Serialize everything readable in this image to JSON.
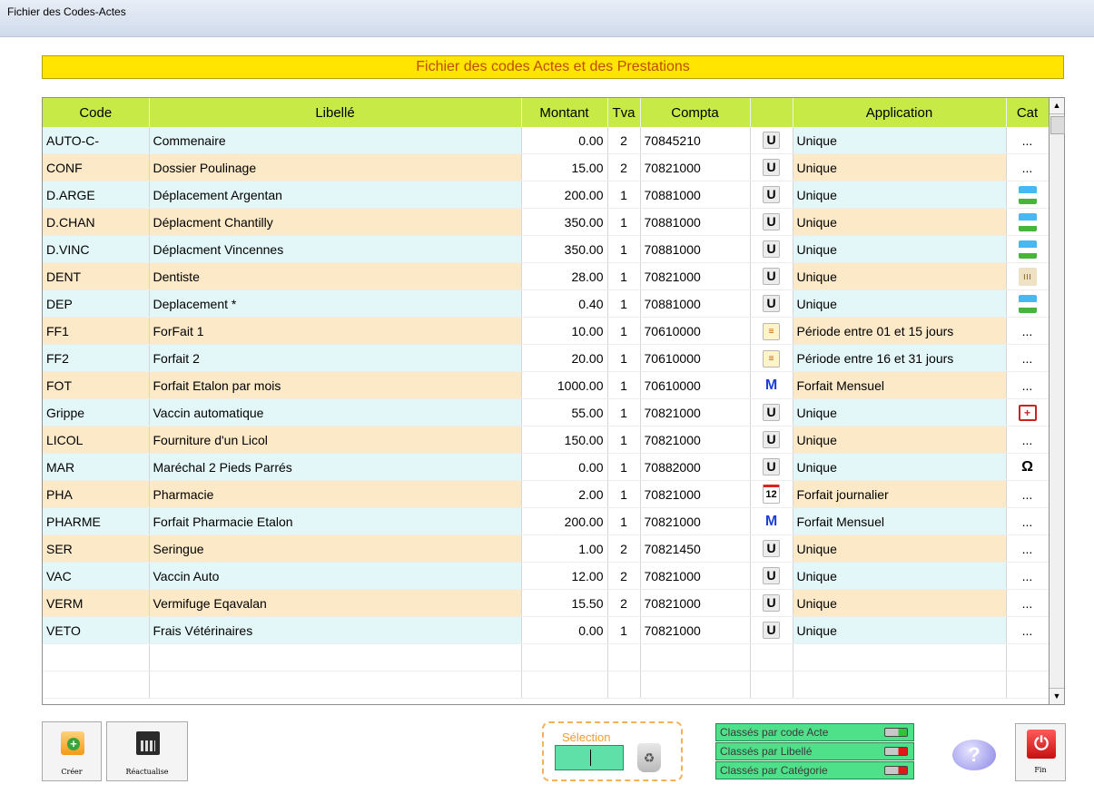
{
  "window": {
    "title": "Fichier des Codes-Actes"
  },
  "banner": {
    "title": "Fichier des codes Actes et des Prestations"
  },
  "table": {
    "headers": {
      "code": "Code",
      "libelle": "Libellé",
      "montant": "Montant",
      "tva": "Tva",
      "compta": "Compta",
      "icon": "",
      "application": "Application",
      "cat": "Cat"
    },
    "rows": [
      {
        "code": "AUTO-C-",
        "libelle": "Commenaire",
        "montant": "0.00",
        "tva": "2",
        "compta": "70845210",
        "app_icon": "U",
        "application": "Unique",
        "cat": "..."
      },
      {
        "code": "CONF",
        "libelle": "Dossier Poulinage",
        "montant": "15.00",
        "tva": "2",
        "compta": "70821000",
        "app_icon": "U",
        "application": "Unique",
        "cat": "..."
      },
      {
        "code": "D.ARGE",
        "libelle": "Déplacement Argentan",
        "montant": "200.00",
        "tva": "1",
        "compta": "70881000",
        "app_icon": "U",
        "application": "Unique",
        "cat": "van-icon"
      },
      {
        "code": "D.CHAN",
        "libelle": "Déplacment Chantilly",
        "montant": "350.00",
        "tva": "1",
        "compta": "70881000",
        "app_icon": "U",
        "application": "Unique",
        "cat": "van-icon"
      },
      {
        "code": "D.VINC",
        "libelle": "Déplacment Vincennes",
        "montant": "350.00",
        "tva": "1",
        "compta": "70881000",
        "app_icon": "U",
        "application": "Unique",
        "cat": "van-icon"
      },
      {
        "code": "DENT",
        "libelle": "Dentiste",
        "montant": "28.00",
        "tva": "1",
        "compta": "70821000",
        "app_icon": "U",
        "application": "Unique",
        "cat": "teeth-icon"
      },
      {
        "code": "DEP",
        "libelle": "Deplacement *",
        "montant": "0.40",
        "tva": "1",
        "compta": "70881000",
        "app_icon": "U",
        "application": "Unique",
        "cat": "van-icon"
      },
      {
        "code": "FF1",
        "libelle": "ForFait 1",
        "montant": "10.00",
        "tva": "1",
        "compta": "70610000",
        "app_icon": "P",
        "application": "Période entre 01 et 15 jours",
        "cat": "..."
      },
      {
        "code": "FF2",
        "libelle": "Forfait 2",
        "montant": "20.00",
        "tva": "1",
        "compta": "70610000",
        "app_icon": "P",
        "application": "Période entre 16 et 31 jours",
        "cat": "..."
      },
      {
        "code": "FOT",
        "libelle": "Forfait Etalon par mois",
        "montant": "1000.00",
        "tva": "1",
        "compta": "70610000",
        "app_icon": "M",
        "application": "Forfait Mensuel",
        "cat": "..."
      },
      {
        "code": "Grippe",
        "libelle": "Vaccin automatique",
        "montant": "55.00",
        "tva": "1",
        "compta": "70821000",
        "app_icon": "U",
        "application": "Unique",
        "cat": "medical-kit-icon"
      },
      {
        "code": "LICOL",
        "libelle": "Fourniture d'un Licol",
        "montant": "150.00",
        "tva": "1",
        "compta": "70821000",
        "app_icon": "U",
        "application": "Unique",
        "cat": "..."
      },
      {
        "code": "MAR",
        "libelle": "Maréchal 2 Pieds Parrés",
        "montant": "0.00",
        "tva": "1",
        "compta": "70882000",
        "app_icon": "U",
        "application": "Unique",
        "cat": "horseshoe-icon"
      },
      {
        "code": "PHA",
        "libelle": "Pharmacie",
        "montant": "2.00",
        "tva": "1",
        "compta": "70821000",
        "app_icon": "J",
        "application": "Forfait journalier",
        "cat": "..."
      },
      {
        "code": "PHARME",
        "libelle": "Forfait Pharmacie Etalon",
        "montant": "200.00",
        "tva": "1",
        "compta": "70821000",
        "app_icon": "M",
        "application": "Forfait Mensuel",
        "cat": "..."
      },
      {
        "code": "SER",
        "libelle": "Seringue",
        "montant": "1.00",
        "tva": "2",
        "compta": "70821450",
        "app_icon": "U",
        "application": "Unique",
        "cat": "..."
      },
      {
        "code": "VAC",
        "libelle": "Vaccin Auto",
        "montant": "12.00",
        "tva": "2",
        "compta": "70821000",
        "app_icon": "U",
        "application": "Unique",
        "cat": "..."
      },
      {
        "code": "VERM",
        "libelle": "Vermifuge Eqavalan",
        "montant": "15.50",
        "tva": "2",
        "compta": "70821000",
        "app_icon": "U",
        "application": "Unique",
        "cat": "..."
      },
      {
        "code": "VETO",
        "libelle": "Frais Vétérinaires",
        "montant": "0.00",
        "tva": "1",
        "compta": "70821000",
        "app_icon": "U",
        "application": "Unique",
        "cat": "..."
      }
    ],
    "empty_rows": 2
  },
  "toolbar": {
    "create_label": "Créer",
    "refresh_label": "Réactualise",
    "fin_label": "Fin"
  },
  "selection": {
    "label": "Sélection",
    "value": ""
  },
  "sort": [
    {
      "label": "Classés par code Acte",
      "state": "on"
    },
    {
      "label": "Classés par Libellé",
      "state": "off"
    },
    {
      "label": "Classés par Catégorie",
      "state": "off"
    }
  ],
  "colors": {
    "header": "#c7ea46",
    "banner": "#ffe500",
    "row_tint_a": "#e3f6f8",
    "row_tint_b": "#fbe9c8"
  }
}
